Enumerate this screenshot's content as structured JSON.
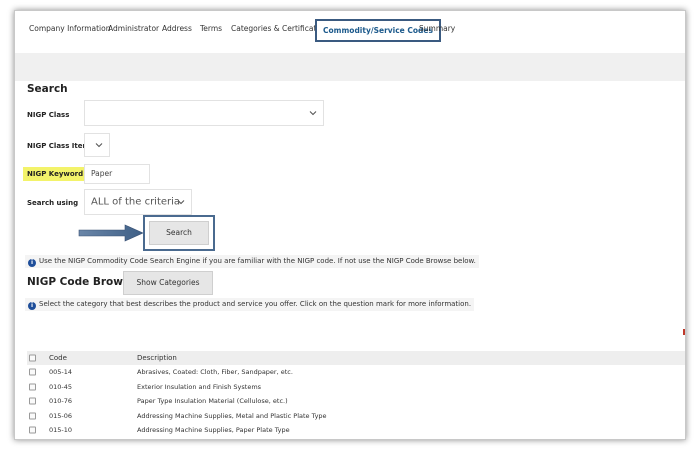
{
  "tabs": [
    {
      "label": "Company Information"
    },
    {
      "label": "Administrator"
    },
    {
      "label": "Address"
    },
    {
      "label": "Terms"
    },
    {
      "label": "Categories & Certifications"
    },
    {
      "label": "Commodity/Service Codes",
      "active": true
    },
    {
      "label": "Summary"
    }
  ],
  "search": {
    "title": "Search",
    "nigp_class_label": "NIGP Class",
    "nigp_class_value": "",
    "nigp_class_item_label": "NIGP Class Item",
    "nigp_class_item_value": "",
    "nigp_keyword_label": "NIGP Keyword",
    "nigp_keyword_value": "Paper",
    "search_using_label": "Search using",
    "search_using_value": "ALL of the criteria",
    "search_button": "Search",
    "info_text": "Use the NIGP Commodity Code Search Engine if you are familiar with the NIGP code. If not use the NIGP Code Browse below."
  },
  "browse": {
    "title": "NIGP Code Browse",
    "show_categories_button": "Show Categories",
    "info_text": "Select the category that best describes the product and service you offer. Click on the question mark for more information."
  },
  "table": {
    "headers": {
      "code": "Code",
      "description": "Description"
    },
    "rows": [
      {
        "code": "005-14",
        "description": "Abrasives, Coated: Cloth, Fiber, Sandpaper, etc."
      },
      {
        "code": "010-45",
        "description": "Exterior Insulation and Finish Systems"
      },
      {
        "code": "010-76",
        "description": "Paper Type Insulation Material (Cellulose, etc.)"
      },
      {
        "code": "015-06",
        "description": "Addressing Machine Supplies, Metal and Plastic Plate Type"
      },
      {
        "code": "015-10",
        "description": "Addressing Machine Supplies, Paper Plate Type"
      }
    ]
  },
  "colors": {
    "active_tab_border": "#3a5a80",
    "highlight": "#f3f36a",
    "arrow": "#4a6a8f",
    "info_icon": "#1f4e9a"
  }
}
